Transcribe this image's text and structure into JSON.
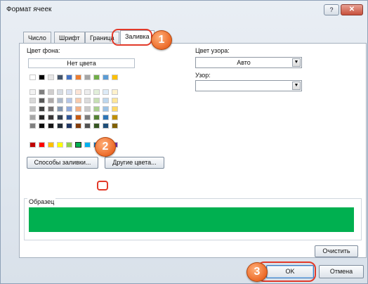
{
  "window": {
    "title": "Формат ячеек",
    "help_label": "?",
    "close_label": "✕"
  },
  "tabs": [
    {
      "label": "Число"
    },
    {
      "label": "Шрифт"
    },
    {
      "label": "Граница"
    },
    {
      "label": "Заливка",
      "active": true
    }
  ],
  "fill": {
    "background_label": "Цвет фона:",
    "no_color_label": "Нет цвета",
    "selected_color": "#00b050",
    "palette_top_row": [
      "#ffffff",
      "#000000",
      "#e7e6e6",
      "#44546a",
      "#4472c4",
      "#ed7d31",
      "#a5a5a5",
      "#70ad47",
      "#5b9bd5",
      "#ffc000"
    ],
    "palette_theme_rows": [
      [
        "#f2f2f2",
        "#7f7f7f",
        "#d0cece",
        "#d6dce4",
        "#d9e1f2",
        "#fce4d6",
        "#ededed",
        "#e2efda",
        "#ddebf7",
        "#fff2cc"
      ],
      [
        "#d9d9d9",
        "#595959",
        "#aeaaaa",
        "#acb9ca",
        "#b4c6e7",
        "#f8cbad",
        "#dbdbdb",
        "#c6e0b4",
        "#bdd7ee",
        "#ffe699"
      ],
      [
        "#bfbfbf",
        "#404040",
        "#757171",
        "#8497b0",
        "#8ea9db",
        "#f4b084",
        "#c9c9c9",
        "#a9d08e",
        "#9bc2e6",
        "#ffd966"
      ],
      [
        "#a6a6a6",
        "#262626",
        "#3a3838",
        "#333f4f",
        "#2f5597",
        "#c65911",
        "#7b7b7b",
        "#548235",
        "#2e75b6",
        "#bf8f00"
      ],
      [
        "#808080",
        "#0d0d0d",
        "#161616",
        "#222b35",
        "#203764",
        "#833c0c",
        "#525252",
        "#375623",
        "#1f4e78",
        "#806000"
      ]
    ],
    "palette_standard_row": [
      "#c00000",
      "#ff0000",
      "#ffc000",
      "#ffff00",
      "#92d050",
      "#00b050",
      "#00b0f0",
      "#0070c0",
      "#002060",
      "#7030a0"
    ],
    "fill_effects_button": "Способы заливки...",
    "more_colors_button": "Другие цвета..."
  },
  "pattern": {
    "color_label": "Цвет узора:",
    "color_value": "Авто",
    "style_label": "Узор:",
    "style_value": ""
  },
  "sample": {
    "label": "Образец"
  },
  "buttons": {
    "clear": "Очистить",
    "ok": "OK",
    "cancel": "Отмена"
  },
  "callouts": [
    "1",
    "2",
    "3"
  ]
}
